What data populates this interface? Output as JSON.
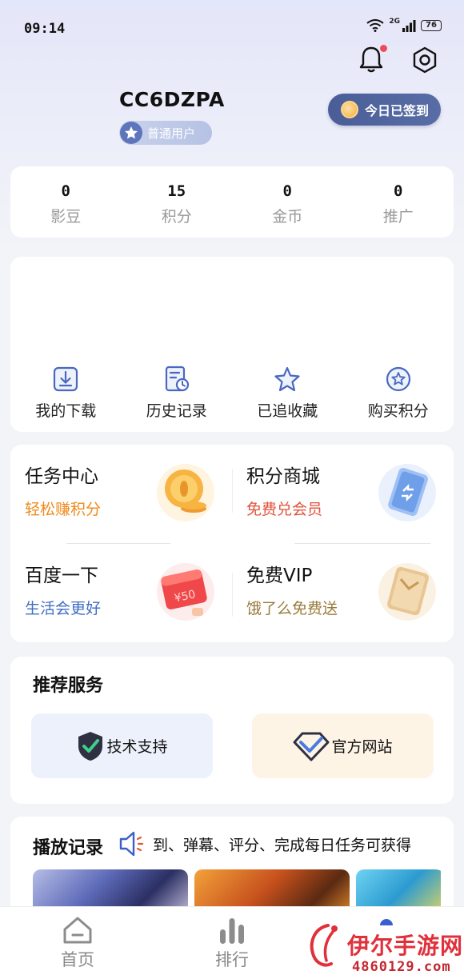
{
  "status_bar": {
    "time": "09:14",
    "network": "2G",
    "battery": "76"
  },
  "profile": {
    "username": "CC6DZPA",
    "user_type": "普通用户",
    "checkin_label": "今日已签到"
  },
  "stats": [
    {
      "value": "0",
      "label": "影豆"
    },
    {
      "value": "15",
      "label": "积分"
    },
    {
      "value": "0",
      "label": "金币"
    },
    {
      "value": "0",
      "label": "推广"
    }
  ],
  "quick_actions": [
    {
      "label": "我的下载",
      "icon": "download-icon"
    },
    {
      "label": "历史记录",
      "icon": "history-icon"
    },
    {
      "label": "已追收藏",
      "icon": "star-icon"
    },
    {
      "label": "购买积分",
      "icon": "star-coin-icon"
    }
  ],
  "tasks": [
    {
      "title": "任务中心",
      "subtitle": "轻松赚积分",
      "subtitle_color": "#f08a1c",
      "icon": "gold-coin-icon"
    },
    {
      "title": "积分商城",
      "subtitle": "免费兑会员",
      "subtitle_color": "#e0533c",
      "icon": "exchange-card-icon"
    },
    {
      "title": "百度一下",
      "subtitle": "生活会更好",
      "subtitle_color": "#3f6ec4",
      "icon": "red-packet-icon"
    },
    {
      "title": "免费VIP",
      "subtitle": "饿了么免费送",
      "subtitle_color": "#9a7a3a",
      "icon": "vip-card-icon"
    }
  ],
  "services": {
    "title": "推荐服务",
    "items": [
      {
        "label": "技术支持",
        "icon": "shield-check-icon",
        "bg": "#edf1fb"
      },
      {
        "label": "官方网站",
        "icon": "diamond-check-icon",
        "bg": "#fdf4e6"
      }
    ]
  },
  "history": {
    "title": "播放记录",
    "marquee": "到、弹幕、评分、完成每日任务可获得"
  },
  "bottom_nav": [
    {
      "label": "首页",
      "icon": "home-icon"
    },
    {
      "label": "排行",
      "icon": "ranking-icon"
    }
  ],
  "watermark": {
    "text": "伊尔手游网",
    "url": "4860129.com"
  }
}
